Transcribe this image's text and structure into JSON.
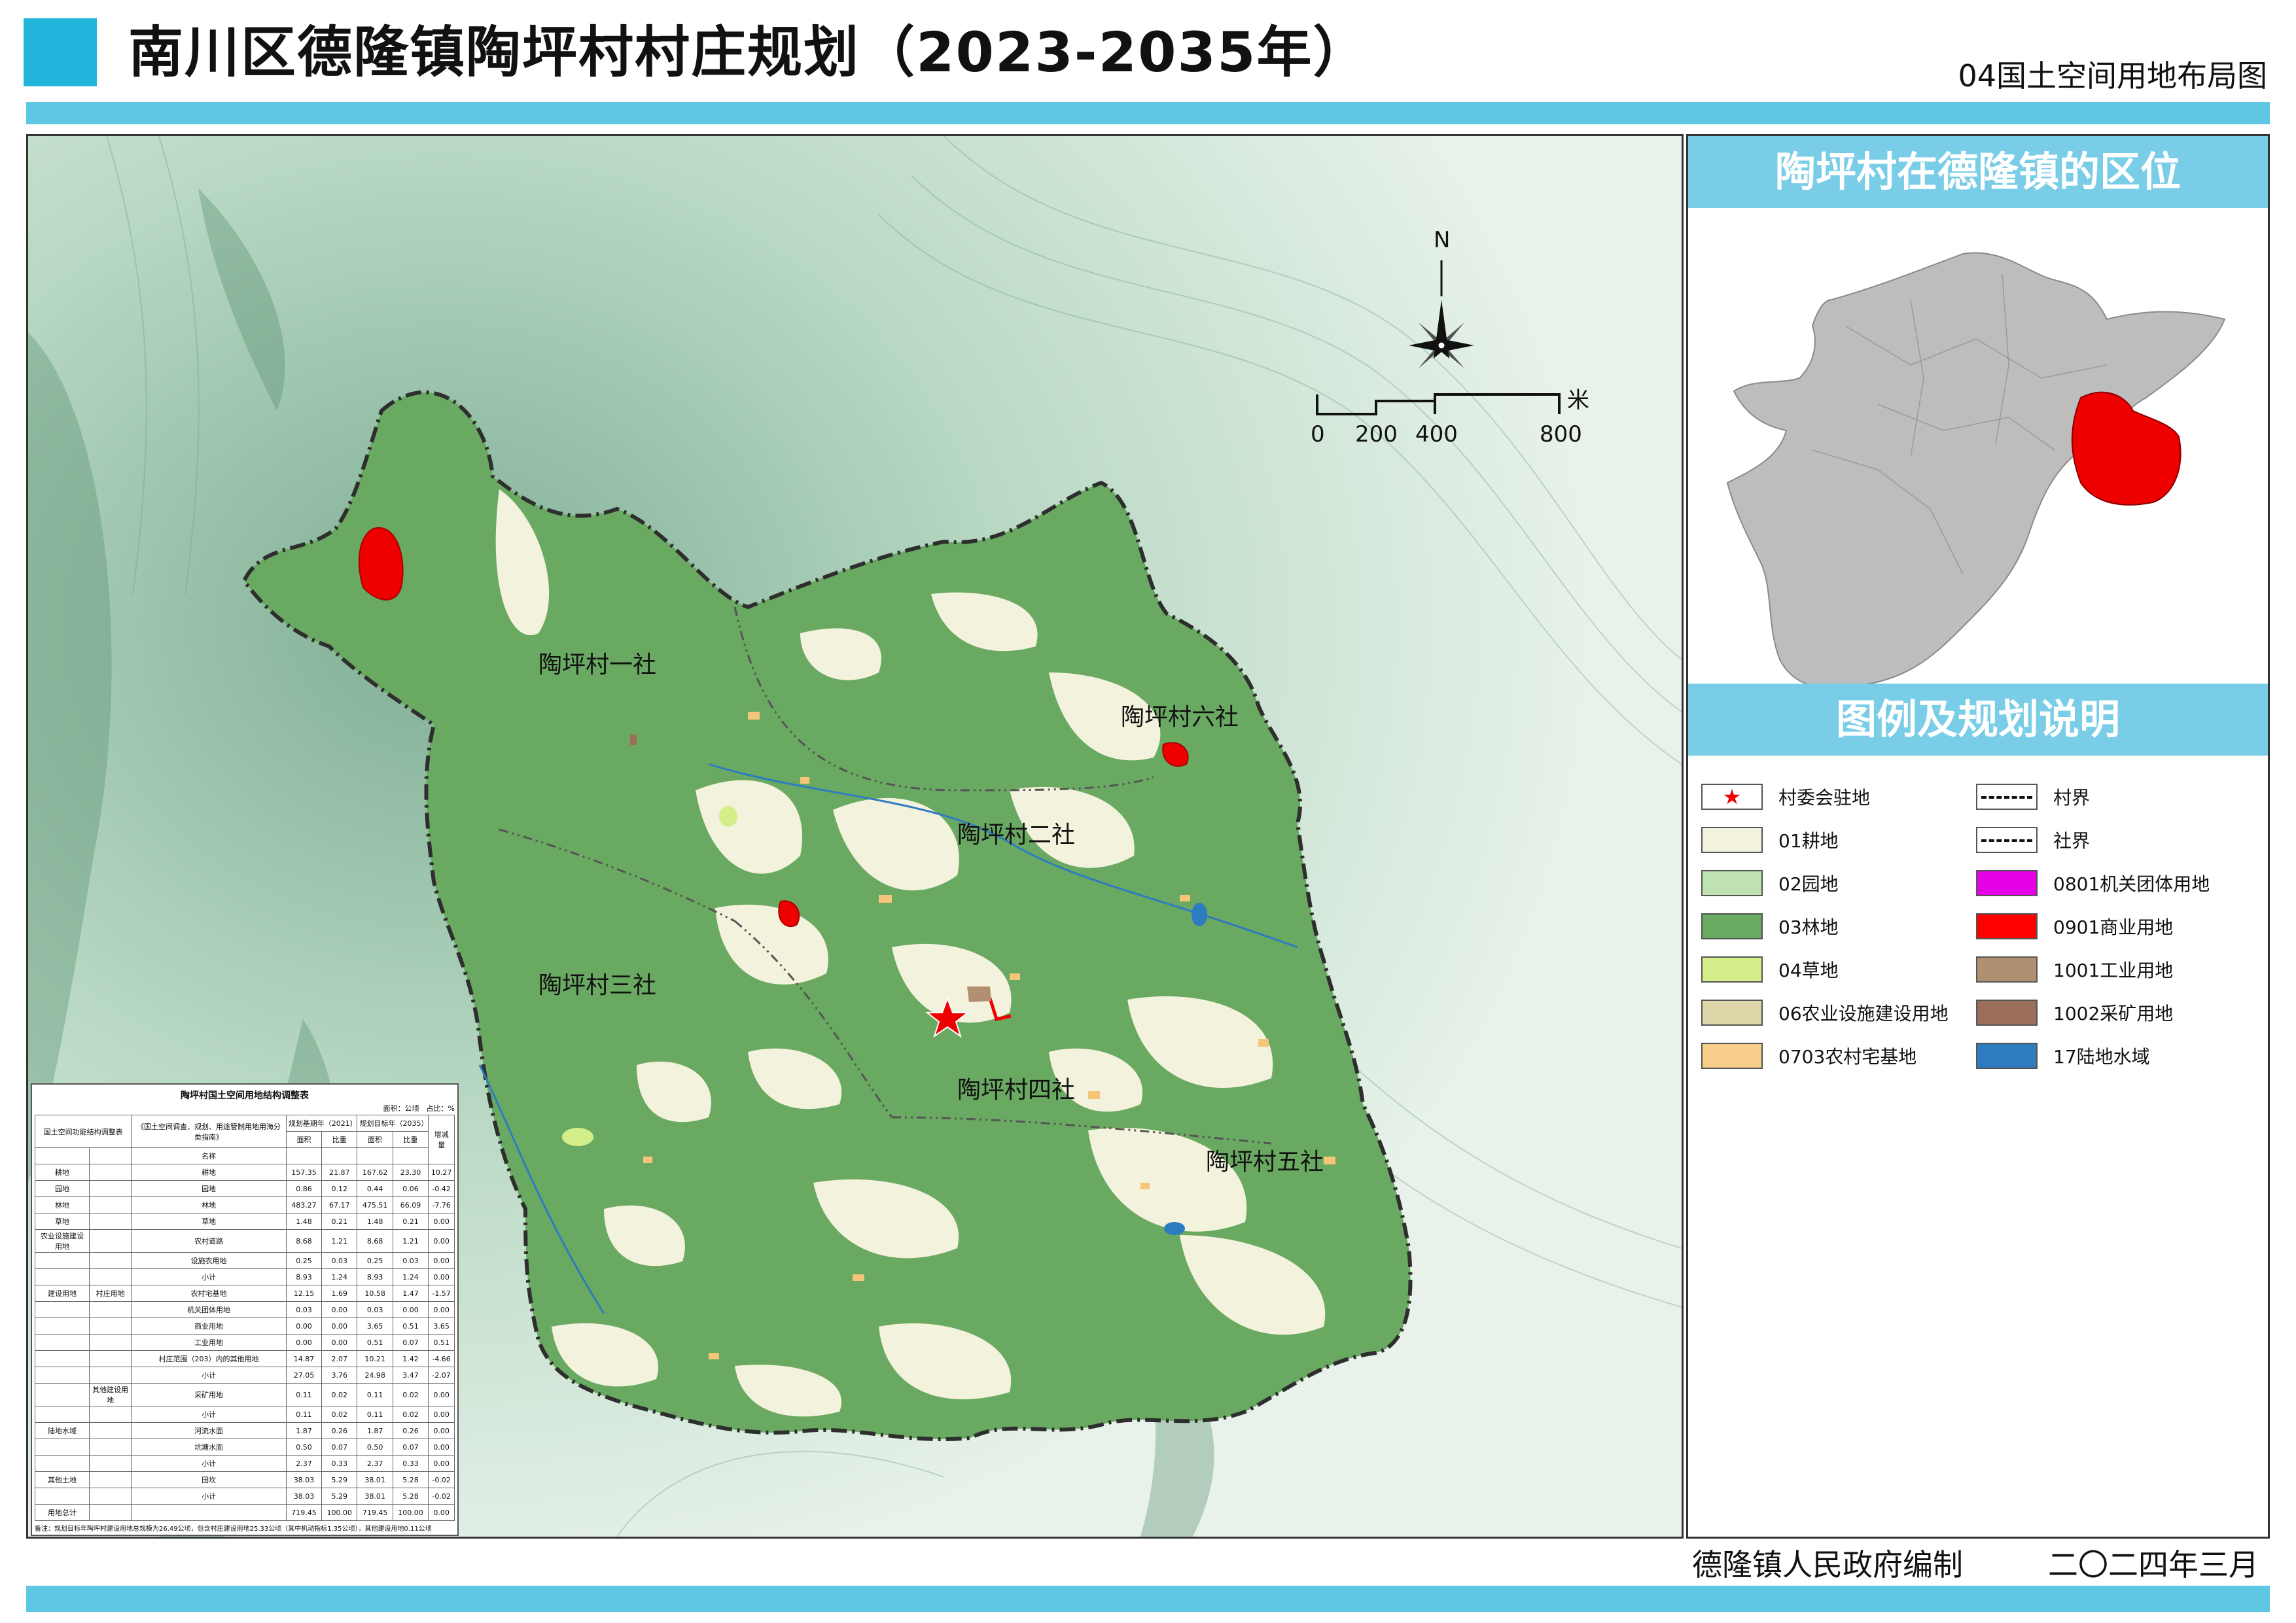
{
  "header": {
    "title": "南川区德隆镇陶坪村村庄规划（2023-2035年）",
    "subtitle": "04国土空间用地布局图"
  },
  "map": {
    "compass_letter": "N",
    "scale_unit": "米",
    "scale_labels": [
      "0",
      "200",
      "400",
      "800"
    ],
    "village_labels": [
      "陶坪村一社",
      "陶坪村二社",
      "陶坪村三社",
      "陶坪村四社",
      "陶坪村五社",
      "陶坪村六社"
    ],
    "colors": {
      "terrain": "#cfe5d6",
      "forest": "#6aa962",
      "farmland": "#f3f2dc",
      "commercial": "#ee0000",
      "industrial": "#b09070",
      "water": "#2d7cc0",
      "rural_homestead": "#f5c57a",
      "grassland": "#d4ee8a",
      "garden": "#bfe3b0"
    }
  },
  "stats_table": {
    "title": "陶坪村国土空间用地结构调整表",
    "unit": "面积：公顷　占比：%",
    "headers": {
      "col1": "国土空间功能结构调整表",
      "col2": "《国土空间调查、规划、用途管制用地用海分类指南》",
      "base_year": "规划基期年（2021）",
      "target_year": "规划目标年（2035）",
      "change": "增减量",
      "name": "名称",
      "area": "面积",
      "ratio": "比重"
    },
    "rows": [
      {
        "g1": "耕地",
        "g2": "",
        "name": "耕地",
        "a1": "157.35",
        "r1": "21.87",
        "a2": "167.62",
        "r2": "23.30",
        "d": "10.27"
      },
      {
        "g1": "园地",
        "g2": "",
        "name": "园地",
        "a1": "0.86",
        "r1": "0.12",
        "a2": "0.44",
        "r2": "0.06",
        "d": "-0.42"
      },
      {
        "g1": "林地",
        "g2": "",
        "name": "林地",
        "a1": "483.27",
        "r1": "67.17",
        "a2": "475.51",
        "r2": "66.09",
        "d": "-7.76"
      },
      {
        "g1": "草地",
        "g2": "",
        "name": "草地",
        "a1": "1.48",
        "r1": "0.21",
        "a2": "1.48",
        "r2": "0.21",
        "d": "0.00"
      },
      {
        "g1": "农业设施建设用地",
        "g2": "",
        "name": "农村道路",
        "a1": "8.68",
        "r1": "1.21",
        "a2": "8.68",
        "r2": "1.21",
        "d": "0.00"
      },
      {
        "g1": "",
        "g2": "",
        "name": "设施农用地",
        "a1": "0.25",
        "r1": "0.03",
        "a2": "0.25",
        "r2": "0.03",
        "d": "0.00"
      },
      {
        "g1": "",
        "g2": "",
        "name": "小计",
        "a1": "8.93",
        "r1": "1.24",
        "a2": "8.93",
        "r2": "1.24",
        "d": "0.00"
      },
      {
        "g1": "建设用地",
        "g2": "村庄用地",
        "name": "农村宅基地",
        "a1": "12.15",
        "r1": "1.69",
        "a2": "10.58",
        "r2": "1.47",
        "d": "-1.57"
      },
      {
        "g1": "",
        "g2": "",
        "name": "机关团体用地",
        "a1": "0.03",
        "r1": "0.00",
        "a2": "0.03",
        "r2": "0.00",
        "d": "0.00"
      },
      {
        "g1": "",
        "g2": "",
        "name": "商业用地",
        "a1": "0.00",
        "r1": "0.00",
        "a2": "3.65",
        "r2": "0.51",
        "d": "3.65"
      },
      {
        "g1": "",
        "g2": "",
        "name": "工业用地",
        "a1": "0.00",
        "r1": "0.00",
        "a2": "0.51",
        "r2": "0.07",
        "d": "0.51"
      },
      {
        "g1": "",
        "g2": "",
        "name": "村庄范围（203）内的其他用地",
        "a1": "14.87",
        "r1": "2.07",
        "a2": "10.21",
        "r2": "1.42",
        "d": "-4.66"
      },
      {
        "g1": "",
        "g2": "",
        "name": "小计",
        "a1": "27.05",
        "r1": "3.76",
        "a2": "24.98",
        "r2": "3.47",
        "d": "-2.07"
      },
      {
        "g1": "",
        "g2": "其他建设用地",
        "name": "采矿用地",
        "a1": "0.11",
        "r1": "0.02",
        "a2": "0.11",
        "r2": "0.02",
        "d": "0.00"
      },
      {
        "g1": "",
        "g2": "",
        "name": "小计",
        "a1": "0.11",
        "r1": "0.02",
        "a2": "0.11",
        "r2": "0.02",
        "d": "0.00"
      },
      {
        "g1": "陆地水域",
        "g2": "",
        "name": "河流水面",
        "a1": "1.87",
        "r1": "0.26",
        "a2": "1.87",
        "r2": "0.26",
        "d": "0.00"
      },
      {
        "g1": "",
        "g2": "",
        "name": "坑塘水面",
        "a1": "0.50",
        "r1": "0.07",
        "a2": "0.50",
        "r2": "0.07",
        "d": "0.00"
      },
      {
        "g1": "",
        "g2": "",
        "name": "小计",
        "a1": "2.37",
        "r1": "0.33",
        "a2": "2.37",
        "r2": "0.33",
        "d": "0.00"
      },
      {
        "g1": "其他土地",
        "g2": "",
        "name": "田坎",
        "a1": "38.03",
        "r1": "5.29",
        "a2": "38.01",
        "r2": "5.28",
        "d": "-0.02"
      },
      {
        "g1": "",
        "g2": "",
        "name": "小计",
        "a1": "38.03",
        "r1": "5.29",
        "a2": "38.01",
        "r2": "5.28",
        "d": "-0.02"
      },
      {
        "g1": "用地总计",
        "g2": "",
        "name": "",
        "a1": "719.45",
        "r1": "100.00",
        "a2": "719.45",
        "r2": "100.00",
        "d": "0.00"
      }
    ],
    "note": "备注：规划目标年陶坪村建设用地总规模为26.49公顷，包含村庄建设用地25.33公顷（其中机动指标1.35公顷），其他建设用地0.11公顷"
  },
  "side": {
    "location_title": "陶坪村在德隆镇的区位",
    "legend_title": "图例及规划说明",
    "legend": [
      {
        "label": "村委会驻地",
        "type": "star",
        "color": "#ee0000"
      },
      {
        "label": "村界",
        "type": "line-dashdot",
        "color": "#111111"
      },
      {
        "label": "01耕地",
        "type": "fill",
        "color": "#f3f2dc"
      },
      {
        "label": "社界",
        "type": "line-dashdotdot",
        "color": "#111111"
      },
      {
        "label": "02园地",
        "type": "fill",
        "color": "#bfe3b0"
      },
      {
        "label": "0801机关团体用地",
        "type": "fill",
        "color": "#e600e6"
      },
      {
        "label": "03林地",
        "type": "fill",
        "color": "#6aa962"
      },
      {
        "label": "0901商业用地",
        "type": "fill",
        "color": "#ff0000"
      },
      {
        "label": "04草地",
        "type": "fill",
        "color": "#d4ee8a"
      },
      {
        "label": "1001工业用地",
        "type": "fill",
        "color": "#b09070"
      },
      {
        "label": "06农业设施建设用地",
        "type": "fill",
        "color": "#dcd6a8"
      },
      {
        "label": "1002采矿用地",
        "type": "fill",
        "color": "#9a6e5a"
      },
      {
        "label": "0703农村宅基地",
        "type": "fill",
        "color": "#f8cf8a"
      },
      {
        "label": "17陆地水域",
        "type": "fill",
        "color": "#2d7cc0"
      }
    ]
  },
  "footer": {
    "author": "德隆镇人民政府编制",
    "date": "二〇二四年三月"
  }
}
